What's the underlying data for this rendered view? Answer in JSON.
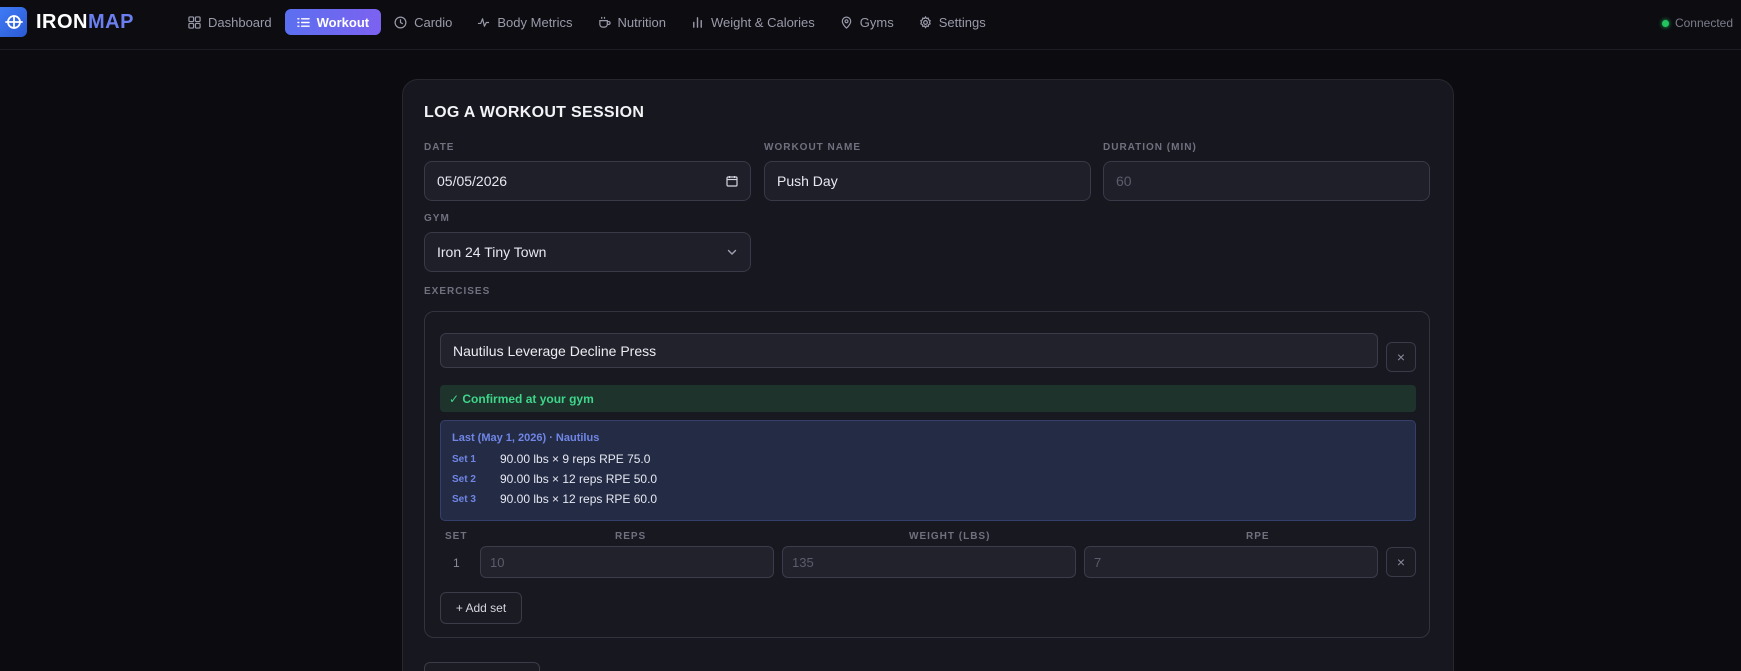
{
  "app": {
    "brand_part1": "IRON",
    "brand_part2": "MAP",
    "status": "Connected",
    "accent": "#5b6ff0",
    "status_color": "#22c55e"
  },
  "nav": [
    {
      "label": "Dashboard",
      "icon": "grid-icon"
    },
    {
      "label": "Workout",
      "icon": "list-icon",
      "active": true
    },
    {
      "label": "Cardio",
      "icon": "clock-icon"
    },
    {
      "label": "Body Metrics",
      "icon": "activity-icon"
    },
    {
      "label": "Nutrition",
      "icon": "coffee-cup-icon"
    },
    {
      "label": "Weight & Calories",
      "icon": "bar-chart-icon"
    },
    {
      "label": "Gyms",
      "icon": "map-pin-icon"
    },
    {
      "label": "Settings",
      "icon": "gear-icon"
    }
  ],
  "form": {
    "title": "LOG A WORKOUT SESSION",
    "date_label": "DATE",
    "date_value": "05/05/2026",
    "name_label": "WORKOUT NAME",
    "name_value": "Push Day",
    "duration_label": "DURATION (MIN)",
    "duration_placeholder": "60",
    "gym_label": "GYM",
    "gym_value": "Iron 24 Tiny Town",
    "exercises_label": "EXERCISES"
  },
  "exercise": {
    "name": "Nautilus Leverage Decline Press",
    "remove": "×",
    "confirmed": "✓ Confirmed at your gym",
    "last_header": "Last (May 1, 2026) · Nautilus",
    "history": [
      {
        "set": "Set 1",
        "value": "90.00 lbs × 9 reps RPE 75.0"
      },
      {
        "set": "Set 2",
        "value": "90.00 lbs × 12 reps RPE 50.0"
      },
      {
        "set": "Set 3",
        "value": "90.00 lbs × 12 reps RPE 60.0"
      }
    ],
    "columns": {
      "set": "SET",
      "reps": "REPS",
      "weight": "WEIGHT (LBS)",
      "rpe": "RPE"
    },
    "row": {
      "num": "1",
      "reps_ph": "10",
      "weight_ph": "135",
      "rpe_ph": "7",
      "remove": "×"
    },
    "add_set": "+ Add set"
  }
}
